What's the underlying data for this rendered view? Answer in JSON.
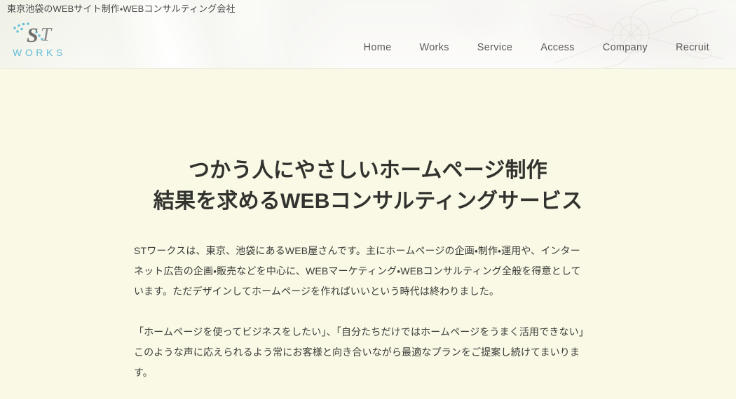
{
  "header": {
    "tagline": "東京池袋のWEBサイト制作・WEBコンサルティング会社",
    "logo": {
      "mark_text": "ST",
      "sub_text": "WORKS",
      "mark_color": "#6e6e6e",
      "sub_color": "#63bcd8",
      "dot_color": "#63bcd8"
    },
    "nav": [
      {
        "label": "Home"
      },
      {
        "label": "Works"
      },
      {
        "label": "Service"
      },
      {
        "label": "Access"
      },
      {
        "label": "Company"
      },
      {
        "label": "Recruit"
      }
    ],
    "background_color": "#f2f1ec",
    "nav_text_color": "#5b5b5b",
    "tagline_color": "#4c4c4c"
  },
  "main": {
    "background_color": "#f9f9e6",
    "heading": {
      "line1": "つかう人にやさしいホームページ制作",
      "line2": "結果を求めるWEBコンサルティングサービス",
      "color": "#32322e"
    },
    "paragraphs": [
      "STワークスは、東京、池袋にあるWEB屋さんです。主にホームページの企画・制作・運用や、インターネット広告の企画・販売などを中心に、WEBマーケティング・WEBコンサルティング全般を得意としています。ただデザインしてホームページを作ればいいという時代は終わりました。",
      "「ホームページを使ってビジネスをしたい」、「自分たちだけではホームページをうまく活用できない」このような声に応えられるよう常にお客様と向き合いながら最適なプランをご提案し続けてまいります。"
    ],
    "paragraph_color": "#3b3b38"
  }
}
